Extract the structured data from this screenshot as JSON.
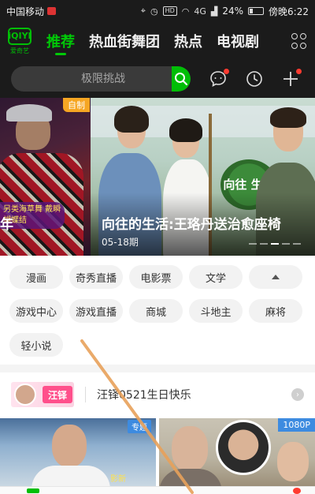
{
  "status_bar": {
    "carrier": "中国移动",
    "network": "4G",
    "hd": "HD",
    "battery": "24%",
    "time": "傍晚6:22"
  },
  "header": {
    "logo_text": "iQIYI",
    "logo_sub": "爱奇艺",
    "tabs": [
      {
        "label": "推荐",
        "active": true
      },
      {
        "label": "热血街舞团",
        "active": false
      },
      {
        "label": "热点",
        "active": false
      },
      {
        "label": "电视剧",
        "active": false
      }
    ],
    "more_icon": "grid-icon"
  },
  "search": {
    "placeholder": "极限挑战",
    "button_icon": "search-icon"
  },
  "header_actions": [
    {
      "icon": "message-icon",
      "badge": true
    },
    {
      "icon": "history-icon",
      "badge": false
    },
    {
      "icon": "plus-icon",
      "badge": true
    }
  ],
  "banner": {
    "left_badge": "自制",
    "left_overlay": "另类海草舞 戴瞬蝴蝶结",
    "left_cut_title": "年",
    "title": "向往的生活:王珞丹送治愈座椅",
    "date": "05-18期",
    "sign_text": "向往 生活"
  },
  "chips": [
    [
      "漫画",
      "奇秀直播",
      "电影票",
      "文学",
      ""
    ],
    [
      "游戏中心",
      "游戏直播",
      "商城",
      "斗地主",
      "麻将"
    ],
    [
      "轻小说"
    ]
  ],
  "birthday": {
    "thumb_name": "汪铎",
    "text": "汪铎0521生日快乐"
  },
  "videos": [
    {
      "badge": "专题",
      "res": "",
      "overlay": "影新"
    },
    {
      "badge": "",
      "res": "1080P",
      "overlay": ""
    }
  ],
  "colors": {
    "brand_green": "#00be06",
    "dark_header": "#1b1b1b",
    "badge_orange": "#f6a623",
    "notify_red": "#ff3b30",
    "annotation_orange": "#e8a15a"
  }
}
